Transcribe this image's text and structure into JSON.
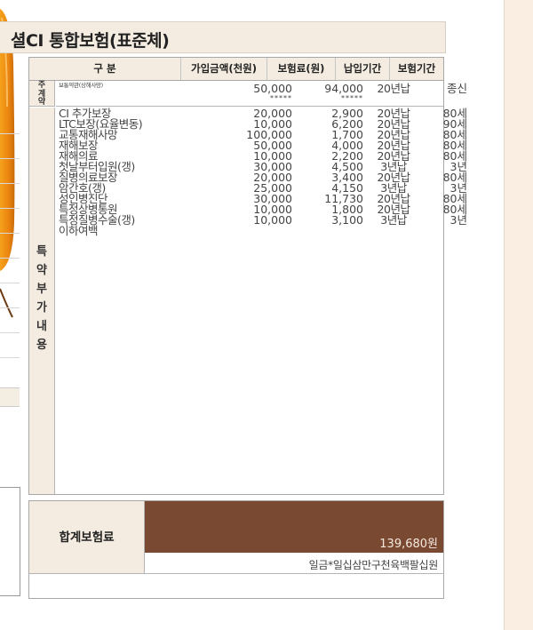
{
  "product_title": "셜CI 통합보험(표준체)",
  "table_headers": {
    "category": "구 분",
    "amount": "가입금액(천원)",
    "premium": "보험료(원)",
    "payment_period": "납입기간",
    "coverage_period": "보험기간"
  },
  "main_contract": {
    "section_label": [
      "주",
      "계",
      "약"
    ],
    "name": "보통약관(상해사망)",
    "amount": "50,000",
    "premium": "94,000",
    "payment_period": "20년납",
    "coverage_period": "종신",
    "amount_mark": "*****",
    "premium_mark": "*****"
  },
  "rider_section_label": [
    "특",
    "약",
    "부",
    "가",
    "내",
    "용"
  ],
  "riders": [
    {
      "name": "CI 추가보장",
      "amount": "20,000",
      "premium": "2,900",
      "payment_period": "20년납",
      "coverage_period": "80세"
    },
    {
      "name": "LTC보장(요율변동)",
      "amount": "10,000",
      "premium": "6,200",
      "payment_period": "20년납",
      "coverage_period": "90세"
    },
    {
      "name": "교통재해사망",
      "amount": "100,000",
      "premium": "1,700",
      "payment_period": "20년납",
      "coverage_period": "80세"
    },
    {
      "name": "재해보장",
      "amount": "50,000",
      "premium": "4,000",
      "payment_period": "20년납",
      "coverage_period": "80세"
    },
    {
      "name": "재해의료",
      "amount": "10,000",
      "premium": "2,200",
      "payment_period": "20년납",
      "coverage_period": "80세"
    },
    {
      "name": "첫날부터입원(갱)",
      "amount": "30,000",
      "premium": "4,500",
      "payment_period": "3년납",
      "coverage_period": "3년"
    },
    {
      "name": "질병의료보장",
      "amount": "20,000",
      "premium": "3,400",
      "payment_period": "20년납",
      "coverage_period": "80세"
    },
    {
      "name": "암간호(갱)",
      "amount": "25,000",
      "premium": "4,150",
      "payment_period": "3년납",
      "coverage_period": "3년"
    },
    {
      "name": "성인병진단",
      "amount": "30,000",
      "premium": "11,730",
      "payment_period": "20년납",
      "coverage_period": "80세"
    },
    {
      "name": "특정상병통원",
      "amount": "10,000",
      "premium": "1,800",
      "payment_period": "20년납",
      "coverage_period": "80세"
    },
    {
      "name": "특정질병수술(갱)",
      "amount": "10,000",
      "premium": "3,100",
      "payment_period": "3년납",
      "coverage_period": "3년"
    },
    {
      "name": "이하여백",
      "amount": "",
      "premium": "",
      "payment_period": "",
      "coverage_period": ""
    }
  ],
  "total": {
    "label": "합계보험료",
    "amount": "139,680원",
    "amount_in_words": "일금*일십삼만구천육백팔십원"
  },
  "colors": {
    "header_tan": "#f4ece1",
    "total_brown": "#7a4932",
    "right_band": "#faeee3",
    "decoration_orange": "#e98a12"
  }
}
